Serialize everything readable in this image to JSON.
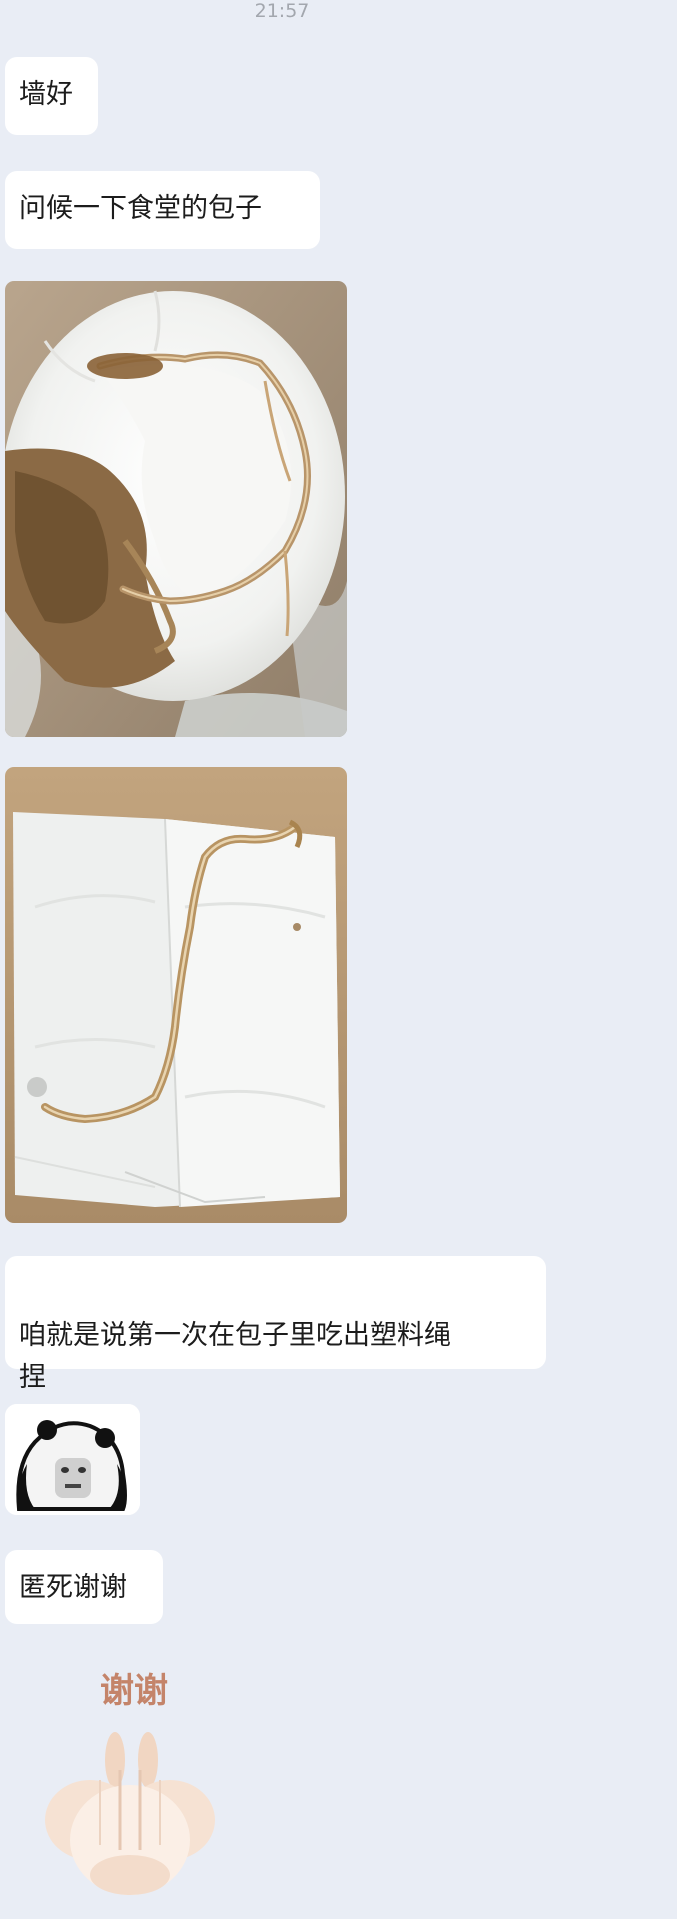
{
  "status": {
    "time": "21:57"
  },
  "messages": [
    {
      "type": "text",
      "text": "墙好"
    },
    {
      "type": "text",
      "text": "问候一下食堂的包子"
    },
    {
      "type": "image",
      "subject": "steamed bun with plastic string"
    },
    {
      "type": "image",
      "subject": "plastic string on paper towel"
    },
    {
      "type": "text",
      "text": "咱就是说第一次在包子里吃出塑料绳\n捏"
    },
    {
      "type": "sticker",
      "subject": "panda meme face"
    },
    {
      "type": "text",
      "text": "匿死谢谢"
    },
    {
      "type": "sticker",
      "subject": "thank you bunny",
      "caption": "谢谢"
    }
  ],
  "colors": {
    "background": "#e9edf5",
    "bubble": "#ffffff",
    "text": "#1c1c1c",
    "timestamp": "#a3a7ae",
    "sticker_caption": "#c4846a"
  }
}
